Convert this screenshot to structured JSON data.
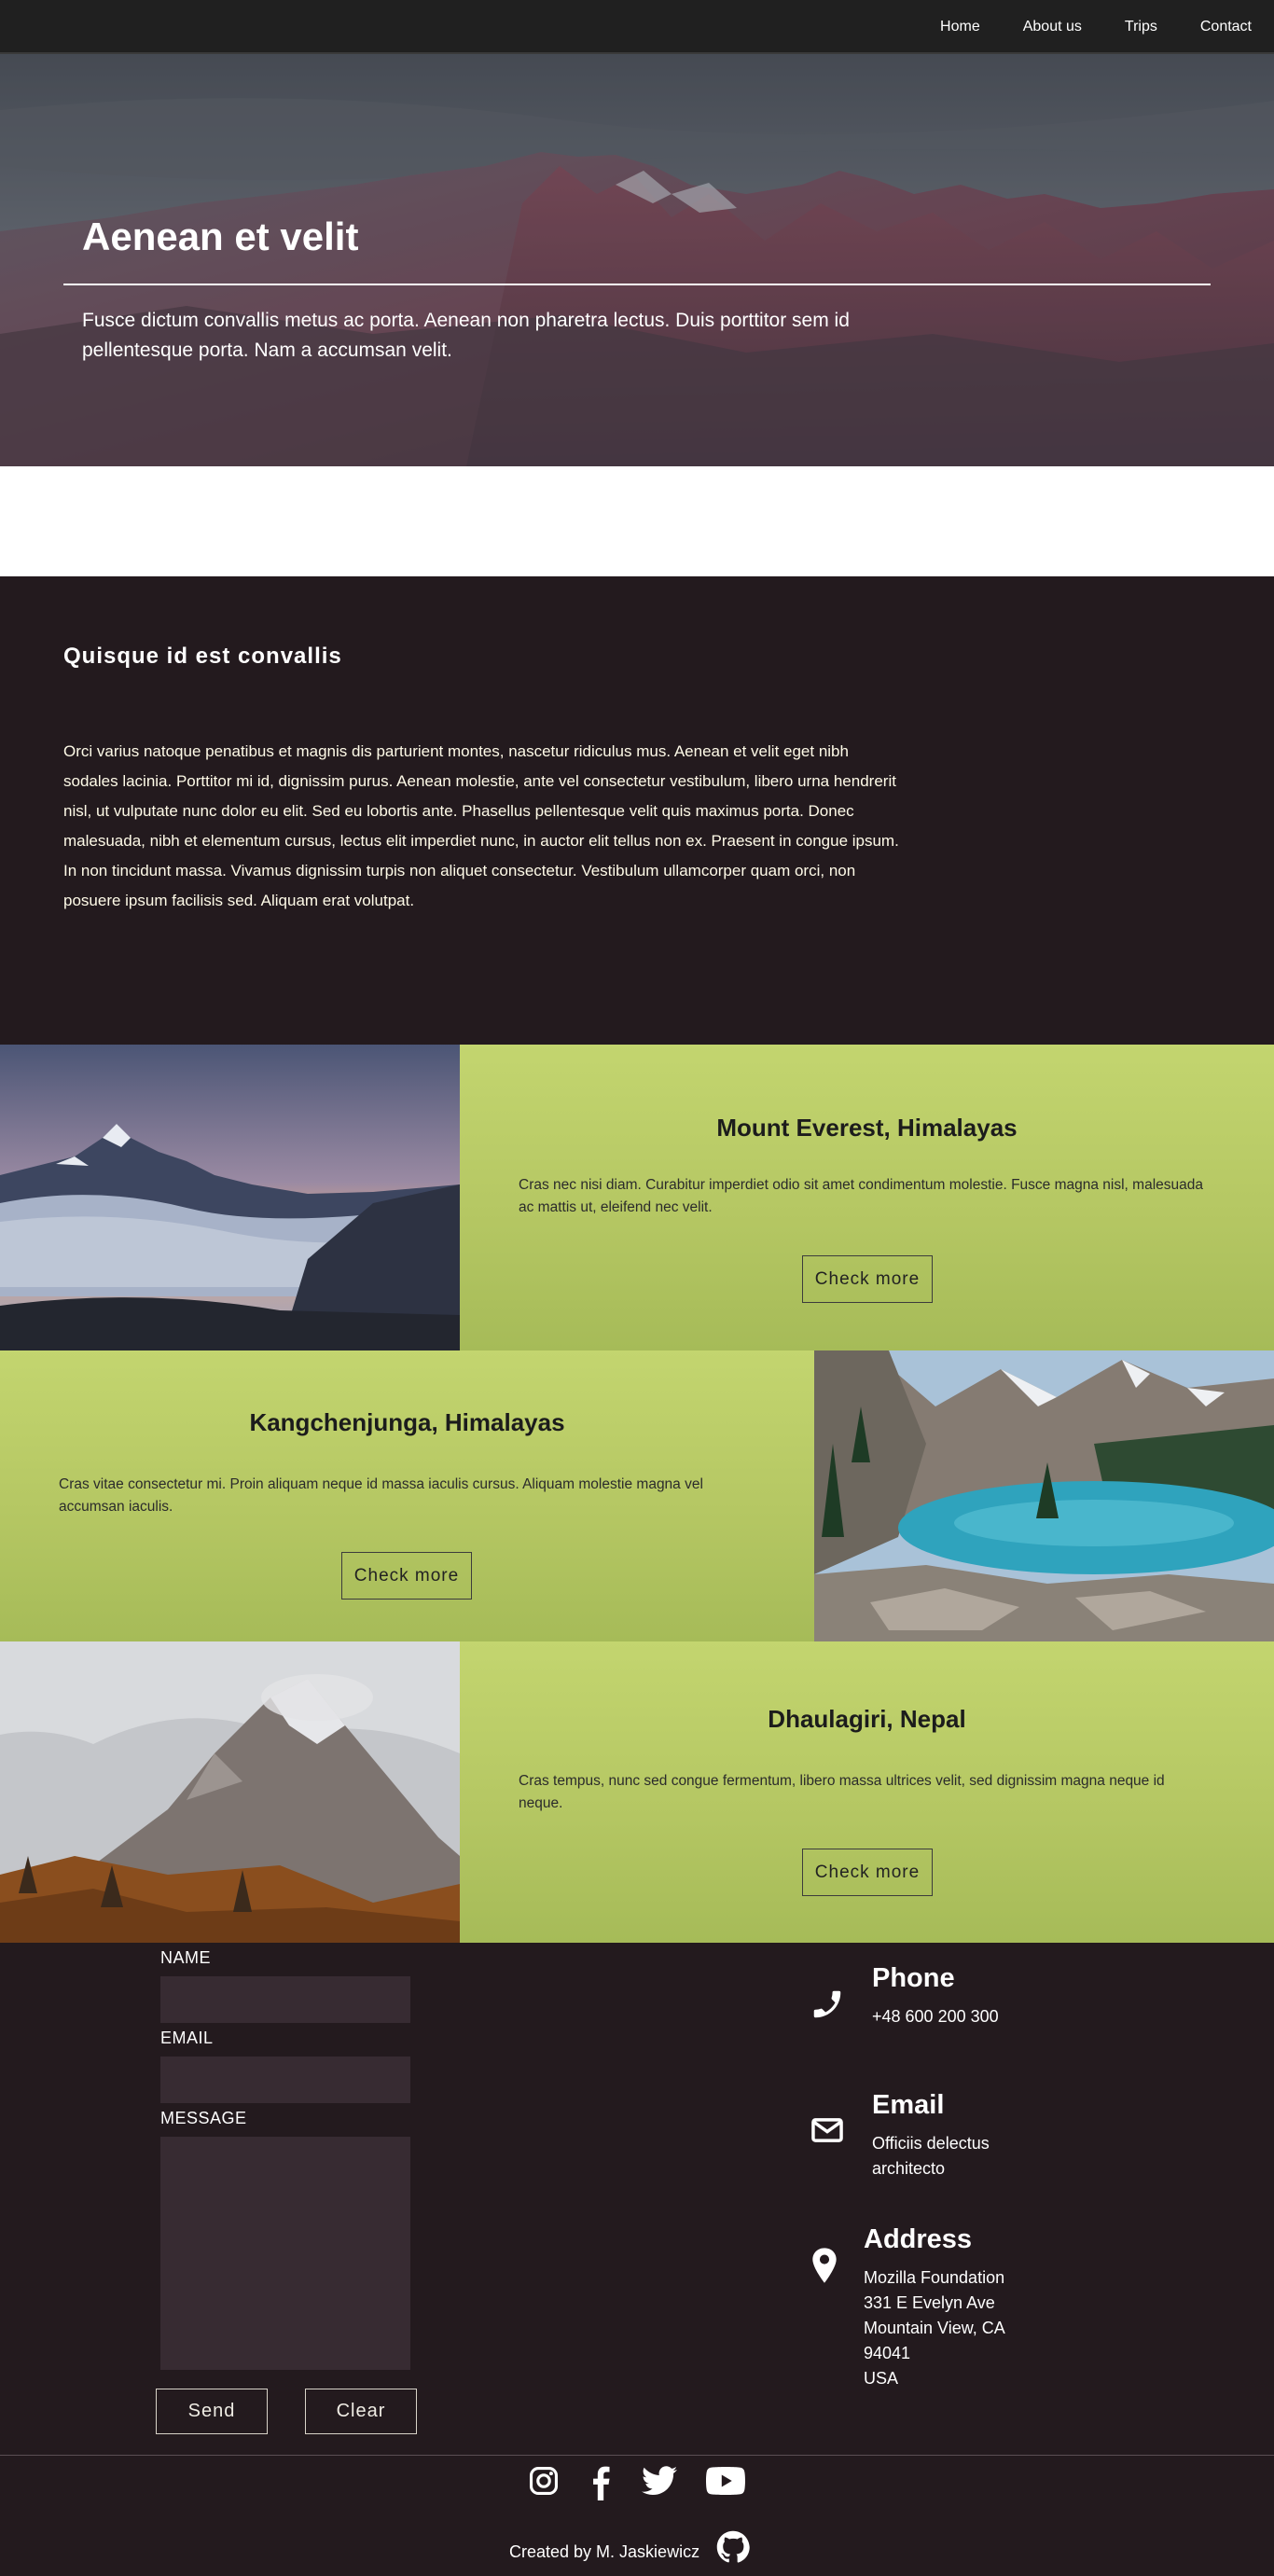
{
  "nav": {
    "items": [
      {
        "label": "Home"
      },
      {
        "label": "About us"
      },
      {
        "label": "Trips"
      },
      {
        "label": "Contact"
      }
    ]
  },
  "hero": {
    "title": "Aenean et velit",
    "text": "Fusce dictum convallis metus ac porta. Aenean non pharetra lectus. Duis porttitor sem id pellentesque porta. Nam a accumsan velit."
  },
  "about": {
    "title": "Quisque id est convallis",
    "text": "Orci varius natoque penatibus et magnis dis parturient montes, nascetur ridiculus mus. Aenean et velit eget nibh sodales lacinia. Porttitor mi id, dignissim purus. Aenean molestie, ante vel consectetur vestibulum, libero urna hendrerit nisl, ut vulputate nunc dolor eu elit. Sed eu lobortis ante. Phasellus pellentesque velit quis maximus porta. Donec malesuada, nibh et elementum cursus, lectus elit imperdiet nunc, in auctor elit tellus non ex. Praesent in congue ipsum. In non tincidunt massa. Vivamus dignissim turpis non aliquet consectetur. Vestibulum ullamcorper quam orci, non posuere ipsum facilisis sed. Aliquam erat volutpat."
  },
  "trips": [
    {
      "title": "Mount Everest, Himalayas",
      "text": "Cras nec nisi diam. Curabitur imperdiet odio sit amet condimentum molestie. Fusce magna nisl, malesuada ac mattis ut, eleifend nec velit.",
      "button": "Check more"
    },
    {
      "title": "Kangchenjunga, Himalayas",
      "text": "Cras vitae consectetur mi. Proin aliquam neque id massa iaculis cursus. Aliquam molestie magna vel accumsan iaculis.",
      "button": "Check more"
    },
    {
      "title": "Dhaulagiri, Nepal",
      "text": "Cras tempus, nunc sed congue fermentum, libero massa ultrices velit, sed dignissim magna neque id neque.",
      "button": "Check more"
    }
  ],
  "form": {
    "name_label": "NAME",
    "name_value": "",
    "email_label": "EMAIL",
    "email_value": "",
    "message_label": "MESSAGE",
    "message_value": "",
    "send_label": "Send",
    "clear_label": "Clear"
  },
  "contact_info": {
    "phone": {
      "heading": "Phone",
      "value": "+48 600 200 300",
      "icon": "phone-icon"
    },
    "email": {
      "heading": "Email",
      "line1": "Officiis delectus",
      "line2": "architecto",
      "icon": "envelope-icon"
    },
    "address": {
      "heading": "Address",
      "line1": "Mozilla Foundation",
      "line2": "331 E Evelyn Ave",
      "line3": "Mountain View, CA",
      "line4": "94041",
      "line5": "USA",
      "icon": "map-pin-icon"
    }
  },
  "footer": {
    "social": [
      "instagram-icon",
      "facebook-icon",
      "twitter-icon",
      "youtube-icon"
    ],
    "credit": "Created by M. Jaskiewicz",
    "github_icon": "github-icon"
  },
  "colors": {
    "nav_bg": "#202020",
    "dark_bg": "#231a1e",
    "trip_green": "#c3d56f",
    "field_bg": "#372b32"
  }
}
